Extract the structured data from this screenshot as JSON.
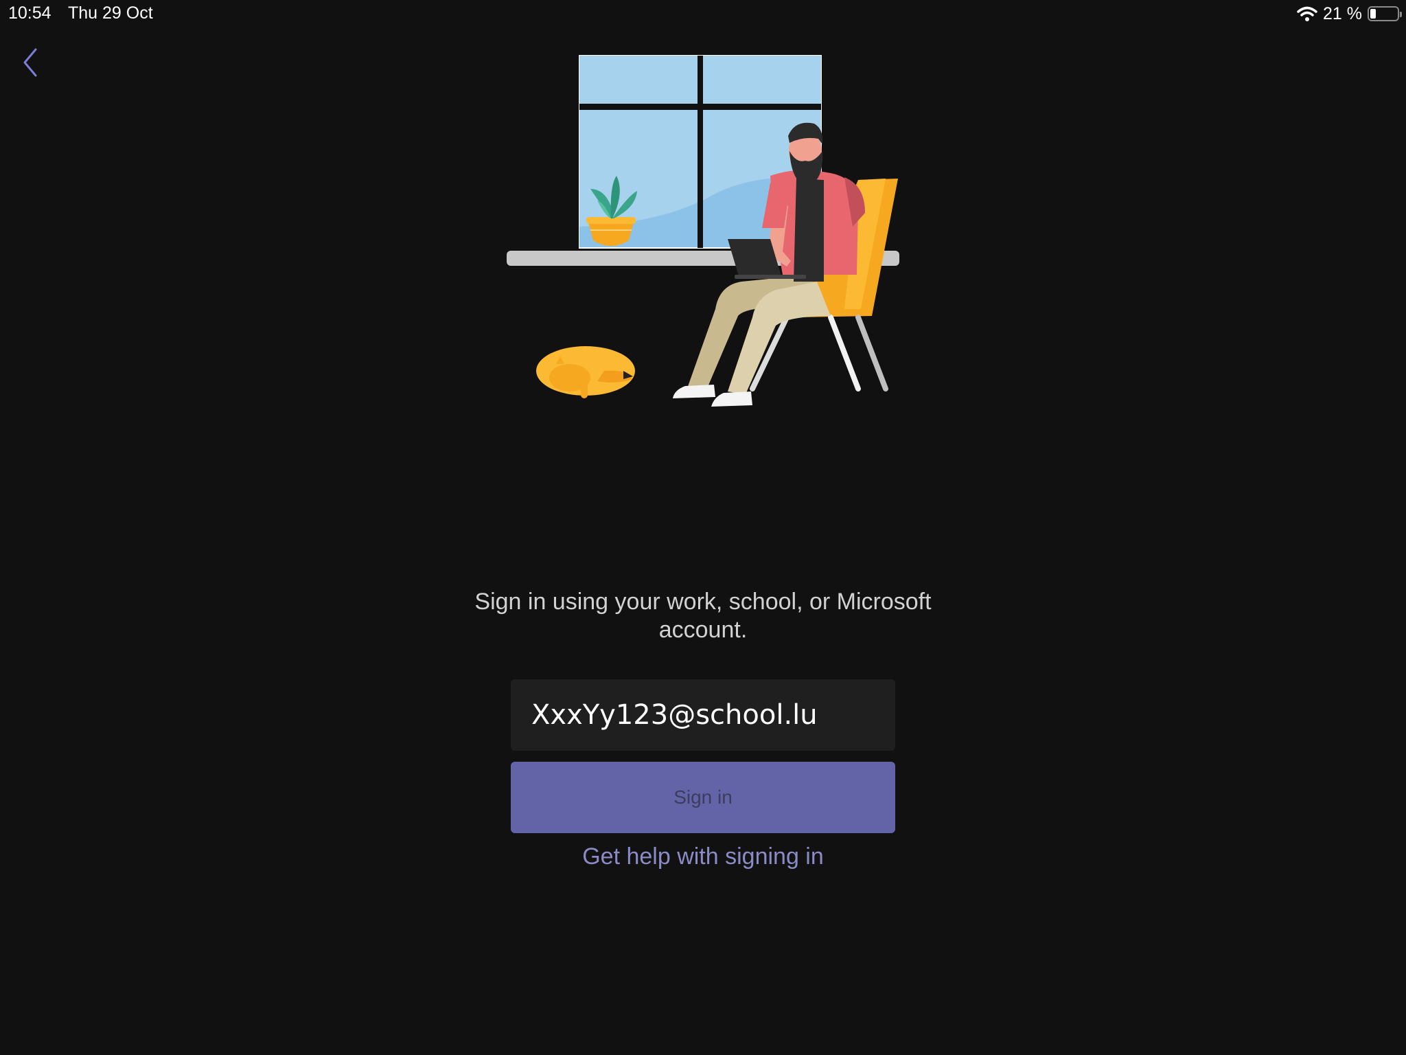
{
  "status_bar": {
    "time": "10:54",
    "date": "Thu 29 Oct",
    "battery_text": "21 %",
    "battery_level": 0.21,
    "wifi_icon": "wifi-icon",
    "battery_icon": "battery-icon"
  },
  "nav": {
    "back_icon": "chevron-left-icon",
    "accent_color": "#7b7fd4"
  },
  "illustration": {
    "description_icon": "person-working-illustration"
  },
  "signin": {
    "prompt": "Sign in using your work, school, or Microsoft account.",
    "email_value": "XxxYy123@school.lu",
    "button_label": "Sign in",
    "help_link": "Get help with signing in",
    "button_color": "#6264a7",
    "link_color": "#8b8cc7"
  }
}
